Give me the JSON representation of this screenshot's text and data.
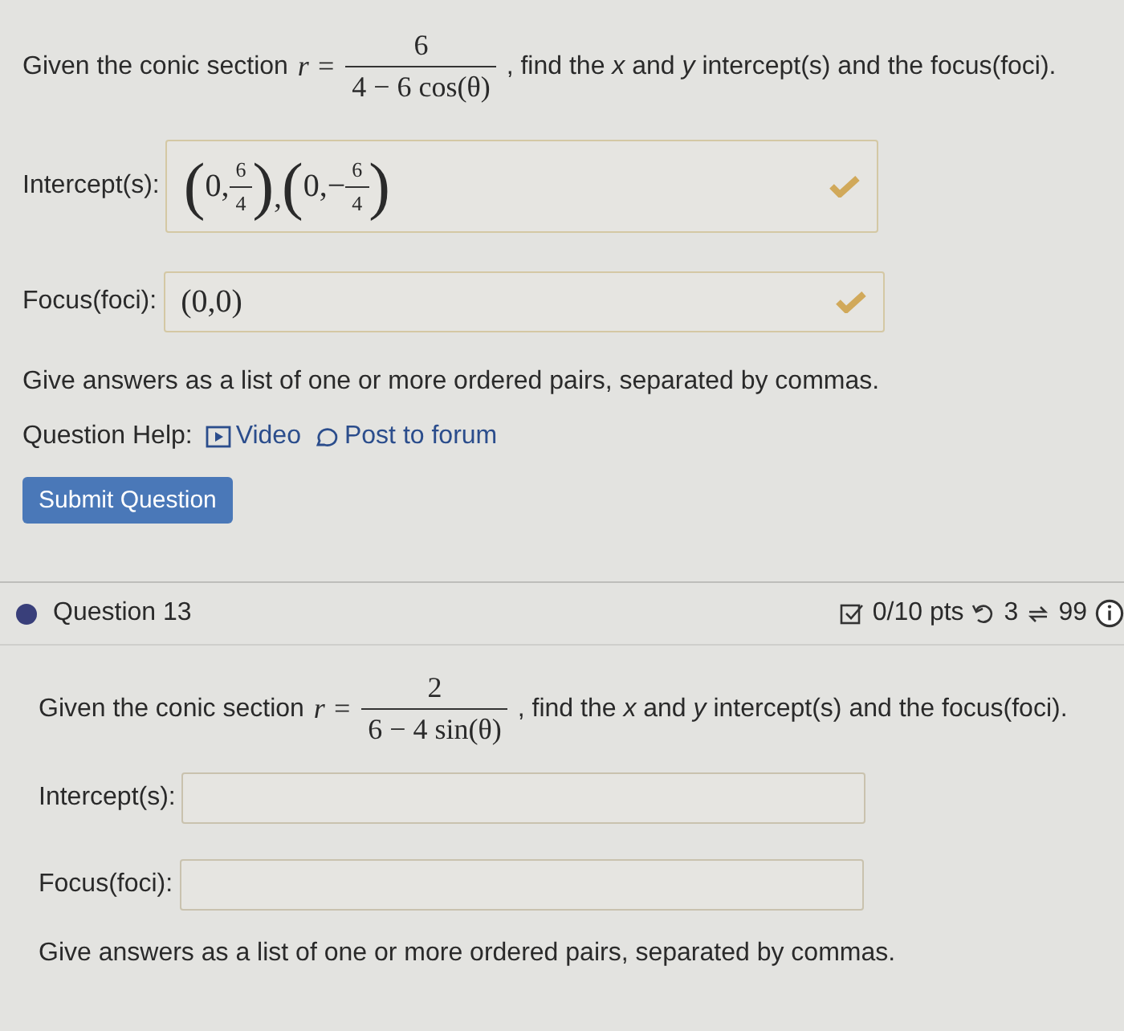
{
  "question_1": {
    "prompt_before": "Given the conic section",
    "variable": "r =",
    "fraction": {
      "numerator": "6",
      "denominator": "4 − 6 cos(θ)"
    },
    "prompt_after": ", find the *x* and *y* intercept(s) and the focus(foci).",
    "answers": [
      {
        "label": "Intercept(s):",
        "correct": true,
        "value": [
          {
            "kind": "paren",
            "open": "(",
            "close": ")",
            "parts": [
              {
                "kind": "text",
                "text": "0,"
              },
              {
                "kind": "fraction",
                "numerator": "6",
                "denominator": "4"
              }
            ]
          },
          {
            "kind": "text",
            "text": ","
          },
          {
            "kind": "paren",
            "open": "(",
            "close": ")",
            "parts": [
              {
                "kind": "text",
                "text": "0,−"
              },
              {
                "kind": "fraction",
                "numerator": "6",
                "denominator": "4"
              }
            ]
          }
        ]
      },
      {
        "label": "Focus(foci):",
        "correct": true,
        "value": [
          {
            "kind": "text",
            "text": "(0,0)"
          }
        ]
      }
    ],
    "instruction": "Give answers as a list of one or more ordered pairs, separated by commas.",
    "help": {
      "label": "Question Help:",
      "links": [
        {
          "kind": "video",
          "label": "Video"
        },
        {
          "kind": "forum",
          "label": "Post to forum"
        }
      ]
    },
    "submit": "Submit Question"
  },
  "question_13": {
    "title": "Question 13",
    "score": "0/10 pts",
    "tries": "3",
    "retries": "99",
    "prompt_before": "Given the conic section",
    "variable": "r =",
    "fraction": {
      "numerator": "2",
      "denominator": "6 − 4 sin(θ)"
    },
    "prompt_after": ", find the *x* and *y* intercept(s) and the focus(foci).",
    "answers": [
      {
        "label": "Intercept(s):"
      },
      {
        "label": "Focus(foci):"
      }
    ],
    "instruction": "Give answers as a list of one or more ordered pairs, separated by commas."
  }
}
